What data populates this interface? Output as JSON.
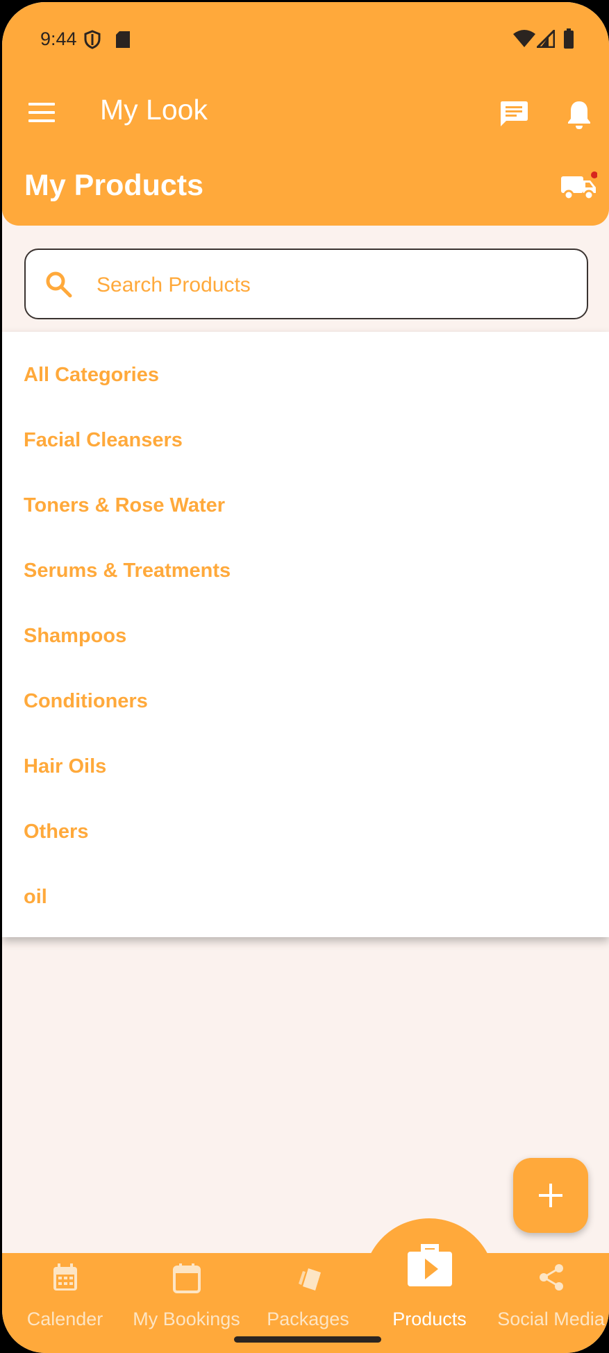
{
  "status_bar": {
    "time": "9:44"
  },
  "app_bar": {
    "app_title": "My Look",
    "page_title": "My Products",
    "menu_icon": "menu-icon",
    "chat_icon": "chat-icon",
    "notification_icon": "bell-icon",
    "delivery_icon": "truck-icon"
  },
  "search": {
    "placeholder": "Search Products",
    "value": ""
  },
  "category_dropdown": {
    "items": [
      "All Categories",
      "Facial Cleansers",
      "Toners & Rose Water",
      "Serums & Treatments",
      "Shampoos",
      "Conditioners",
      "Hair Oils",
      "Others",
      "oil"
    ]
  },
  "fab": {
    "icon": "plus-icon"
  },
  "bottom_nav": {
    "items": [
      {
        "label": "Calender",
        "icon": "calendar-grid-icon"
      },
      {
        "label": "My Bookings",
        "icon": "calendar-icon"
      },
      {
        "label": "Packages",
        "icon": "packages-icon"
      },
      {
        "label": "Products",
        "icon": "products-play-bag-icon",
        "active": true
      },
      {
        "label": "Social Media",
        "icon": "share-icon"
      }
    ]
  },
  "colors": {
    "primary": "#ffa93b",
    "background": "#fbf2ee",
    "notification_dot": "#d7261e"
  }
}
